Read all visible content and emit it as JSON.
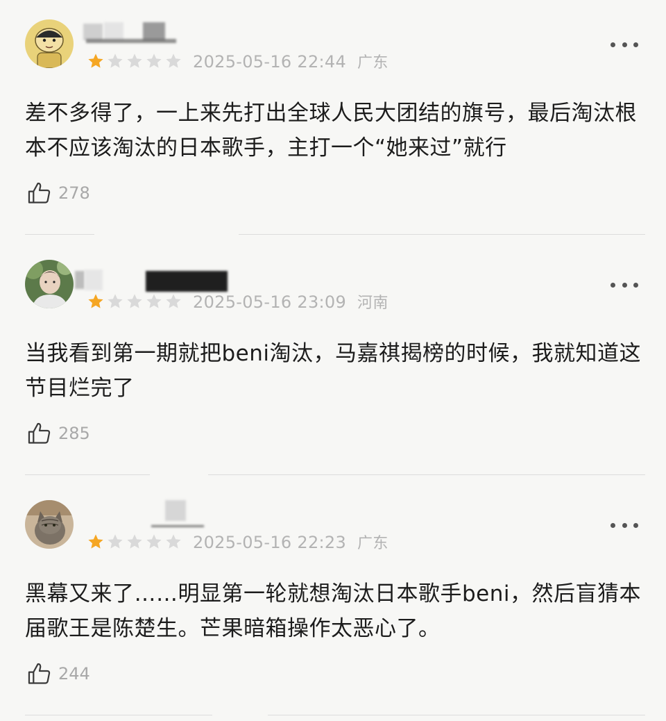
{
  "colors": {
    "star_filled": "#f5a623",
    "star_empty": "#d9d9d9",
    "meta_text": "#b3b3b3",
    "background": "#f7f7f5"
  },
  "reviews": [
    {
      "avatar_icon": "cartoon-boy-avatar",
      "rating": 1,
      "rating_max": 5,
      "date": "2025-05-16 22:44",
      "region": "广东",
      "content": "差不多得了，一上来先打出全球人民大团结的旗号，最后淘汰根本不应该淘汰的日本歌手，主打一个“她来过”就行",
      "likes": "278"
    },
    {
      "avatar_icon": "person-photo-avatar",
      "rating": 1,
      "rating_max": 5,
      "date": "2025-05-16 23:09",
      "region": "河南",
      "content": "当我看到第一期就把beni淘汰，马嘉祺揭榜的时候，我就知道这节目烂完了",
      "likes": "285"
    },
    {
      "avatar_icon": "cat-photo-avatar",
      "rating": 1,
      "rating_max": 5,
      "date": "2025-05-16 22:23",
      "region": "广东",
      "content": "黑幕又来了……明显第一轮就想淘汰日本歌手beni，然后盲猜本届歌王是陈楚生。芒果暗箱操作太恶心了。",
      "likes": "244"
    }
  ]
}
